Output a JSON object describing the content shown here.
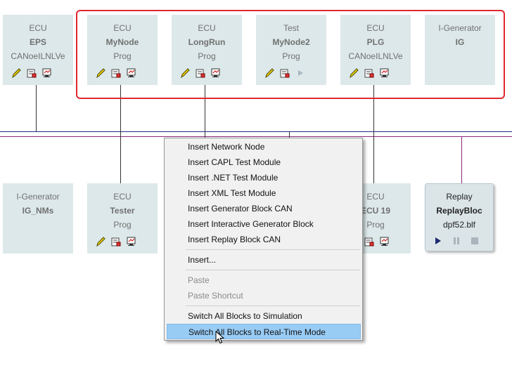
{
  "top_blocks": [
    {
      "type": "ECU",
      "name": "EPS",
      "sub": "CANoeILNLVe",
      "icons": [
        "pencil-icon",
        "db-icon",
        "sim-icon"
      ]
    },
    {
      "type": "ECU",
      "name": "MyNode",
      "sub": "Prog",
      "icons": [
        "pencil-icon",
        "db-icon",
        "sim-icon"
      ]
    },
    {
      "type": "ECU",
      "name": "LongRun",
      "sub": "Prog",
      "icons": [
        "pencil-icon",
        "db-icon",
        "sim-icon"
      ]
    },
    {
      "type": "Test",
      "name": "MyNode2",
      "sub": "Prog",
      "icons": [
        "pencil-icon",
        "db-icon",
        "play-icon"
      ]
    },
    {
      "type": "ECU",
      "name": "PLG",
      "sub": "CANoeILNLVe",
      "icons": [
        "pencil-icon",
        "db-icon",
        "sim-icon"
      ]
    },
    {
      "type": "I-Generator",
      "name": "IG",
      "sub": "",
      "icons": []
    }
  ],
  "bottom_blocks": [
    {
      "type": "I-Generator",
      "name": "IG_NMs",
      "sub": "",
      "icons": []
    },
    {
      "type": "ECU",
      "name": "Tester",
      "sub": "Prog",
      "icons": [
        "pencil-icon",
        "db-icon",
        "sim-icon"
      ]
    },
    {
      "type": "ECU",
      "name": "ECU 19",
      "sub": "Prog",
      "icons": [
        "db-icon",
        "sim-icon"
      ]
    }
  ],
  "replay_block": {
    "type": "Replay",
    "name": "ReplayBloc",
    "file": "dpf52.blf"
  },
  "context_menu": {
    "group1": [
      "Insert Network Node",
      "Insert CAPL Test Module",
      "Insert .NET Test Module",
      "Insert XML Test Module",
      "Insert Generator Block CAN",
      "Insert Interactive Generator Block",
      "Insert Replay Block CAN"
    ],
    "group2": [
      "Insert..."
    ],
    "group3": [
      "Paste",
      "Paste Shortcut"
    ],
    "group4": [
      "Switch All Blocks to Simulation",
      "Switch All Blocks to Real-Time Mode"
    ]
  },
  "colors": {
    "block_bg": "#dde8ea",
    "highlight": "#99ccf5",
    "selection_border": "#e0282e",
    "bus_blue": "#1f2d80",
    "bus_purple": "#8a2a7a"
  }
}
